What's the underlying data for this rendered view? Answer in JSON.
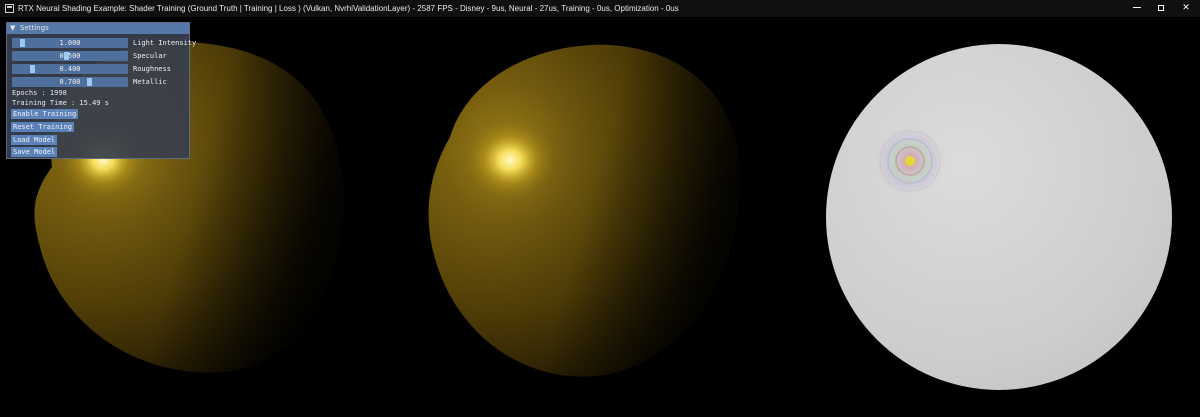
{
  "window": {
    "title": "RTX Neural Shading Example: Shader Training (Ground Truth | Training | Loss ) (Vulkan, NvrhiValidationLayer) - 2587 FPS  - Disney -   9us, Neural -  27us, Training -   0us, Optimization -   0us",
    "controls": [
      "minimize",
      "maximize",
      "close"
    ]
  },
  "icons": {
    "app": "app-window-icon",
    "minimize": "minimize-icon",
    "maximize": "maximize-icon",
    "close": "close-icon",
    "collapse": "collapse-arrow-icon"
  },
  "settings": {
    "header": "Settings",
    "arrow": "▼",
    "sliders": [
      {
        "label": "Light Intensity",
        "value": "1.000",
        "fraction": 0.07
      },
      {
        "label": "Specular",
        "value": "0.500",
        "fraction": 0.47
      },
      {
        "label": "Roughness",
        "value": "0.400",
        "fraction": 0.16
      },
      {
        "label": "Metallic",
        "value": "0.700",
        "fraction": 0.68
      }
    ],
    "epochs": "Epochs : 1998",
    "training_time": "Training Time : 15.49 s",
    "buttons": {
      "enable_training": "Enable Training",
      "reset_training": "Reset Training",
      "load_model": "Load Model",
      "save_model": "Save Model"
    }
  },
  "colors": {
    "background": "#000000",
    "titlebar": "#101010",
    "panel_bg": "#383e4c",
    "panel_header": "#5479a8",
    "slider_track": "#4f6f9c",
    "slider_grab": "#9bc7f4",
    "button": "#5a82b8",
    "sphere_base": "#6e5508",
    "sphere_highlight": "#fff6a0",
    "loss_sphere": "#c9c9c9"
  }
}
